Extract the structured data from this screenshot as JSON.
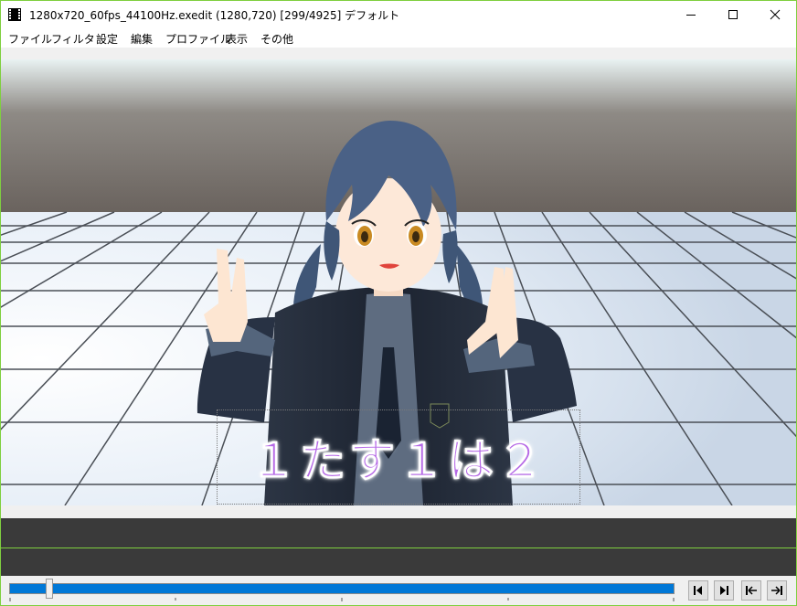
{
  "window": {
    "title": "1280x720_60fps_44100Hz.exedit (1280,720)  [299/4925]  デフォルト",
    "controls": [
      "minimize-icon",
      "maximize-icon",
      "close-icon"
    ]
  },
  "menu": {
    "items": [
      "ファイル",
      "フィルタ",
      "設定",
      "編集",
      "プロファイル",
      "表示",
      "その他"
    ]
  },
  "preview": {
    "caption": "１たす１は２",
    "caption_color": "#b66ae6"
  },
  "playback": {
    "current_frame": 299,
    "total_frames": 4925,
    "progress": 0.061,
    "accent": "#0078d7",
    "buttons": [
      "prev-frame-icon",
      "next-frame-icon",
      "jump-start-icon",
      "jump-end-icon"
    ]
  }
}
